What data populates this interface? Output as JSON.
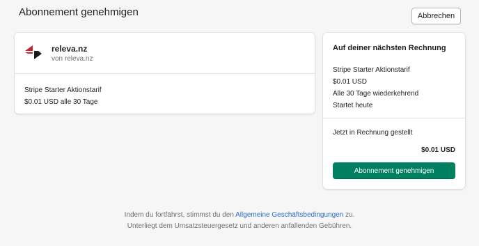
{
  "header": {
    "title": "Abonnement genehmigen",
    "cancel_label": "Abbrechen"
  },
  "app": {
    "name": "releva.nz",
    "by": "von releva.nz",
    "logo_icon": "releva-logo-icon",
    "plan_name": "Stripe Starter Aktionstarif",
    "plan_price": "$0.01 USD alle 30 Tage"
  },
  "summary": {
    "title": "Auf deiner nächsten Rechnung",
    "lines": [
      "Stripe Starter Aktionstarif",
      "$0.01 USD",
      "Alle 30 Tage wiederkehrend",
      "Startet heute"
    ],
    "billed_label": "Jetzt in Rechnung gestellt",
    "billed_amount": "$0.01 USD",
    "approve_label": "Abonnement genehmigen"
  },
  "footer": {
    "line1_before": "Indem du fortfährst, stimmst du den ",
    "terms_link": "Allgemeine Geschäftsbedingungen",
    "line1_after": " zu.",
    "line2": "Unterliegt dem Umsatzsteuergesetz und anderen anfallenden Gebühren."
  },
  "colors": {
    "primary": "#008060",
    "link": "#2c6ecb",
    "logo_red": "#d0202e",
    "logo_dark": "#1a1a1a"
  }
}
